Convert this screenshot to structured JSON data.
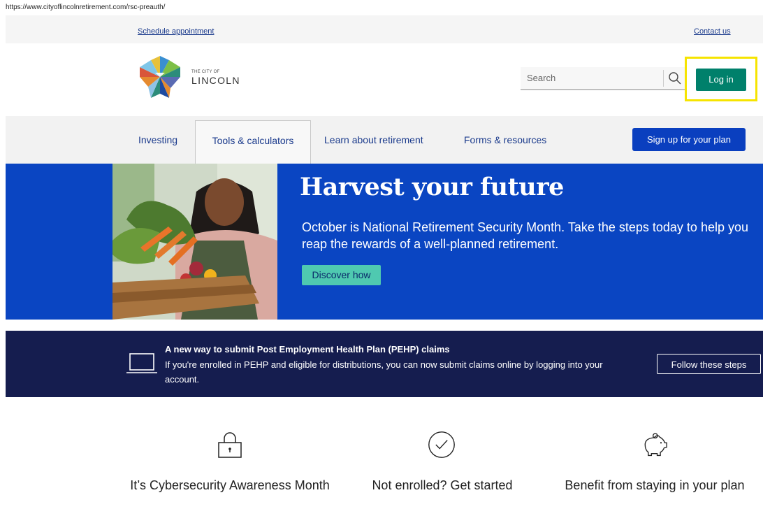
{
  "browser": {
    "url": "https://www.cityoflincolnretirement.com/rsc-preauth/"
  },
  "utility": {
    "schedule": "Schedule appointment",
    "contact": "Contact us"
  },
  "header": {
    "logo_small": "THE CITY OF",
    "logo_big": "LINCOLN",
    "search_placeholder": "Search",
    "search_icon": "search-icon",
    "login_label": "Log in",
    "highlight_color": "#f6e400"
  },
  "nav": {
    "items": [
      {
        "label": "Investing"
      },
      {
        "label": "Tools & calculators",
        "active": true
      },
      {
        "label": "Learn about retirement"
      },
      {
        "label": "Forms & resources"
      }
    ],
    "signup_label": "Sign up for your plan"
  },
  "hero": {
    "title": "Harvest your future",
    "text": "October is National Retirement Security Month. Take the steps today to help you reap the rewards of a well-planned retirement.",
    "button": "Discover how",
    "bg_color": "#0a45c2"
  },
  "banner": {
    "icon": "laptop-icon",
    "title": "A new way to submit Post Employment Health Plan (PEHP) claims",
    "text": "If you're enrolled in PEHP and eligible for distributions, you can now submit claims online by logging into your account.",
    "button": "Follow these steps",
    "bg_color": "#151d4f"
  },
  "features": [
    {
      "icon": "lock-icon",
      "label": "It’s Cybersecurity Awareness Month"
    },
    {
      "icon": "check-circle-icon",
      "label": "Not enrolled? Get started"
    },
    {
      "icon": "piggy-bank-icon",
      "label": "Benefit from staying in your plan"
    }
  ],
  "colors": {
    "brand_green": "#00806b",
    "brand_blue": "#0a3fbf",
    "link": "#1a3a8c",
    "teal_button": "#4fc9b0"
  }
}
